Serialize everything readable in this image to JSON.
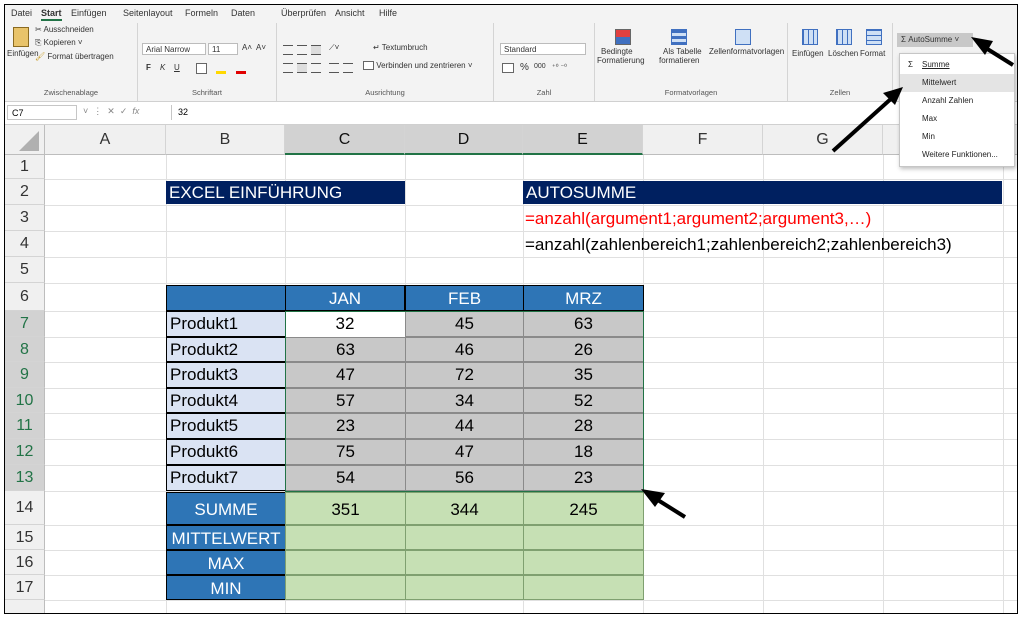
{
  "menu": {
    "tabs": [
      "Datei",
      "Start",
      "Einfügen",
      "Seitenlayout",
      "Formeln",
      "Daten",
      "Überprüfen",
      "Ansicht",
      "Hilfe"
    ]
  },
  "ribbon": {
    "clipboard": {
      "paste_label": "Einfügen",
      "cut_label": "Ausschneiden",
      "copy_label": "Kopieren",
      "format_painter_label": "Format übertragen",
      "group_label": "Zwischenablage"
    },
    "font": {
      "font_name": "Arial Narrow",
      "font_size": "11",
      "grow_label": "A˄",
      "shrink_label": "A˅",
      "bold": "F",
      "italic": "K",
      "underline": "U",
      "group_label": "Schriftart"
    },
    "alignment": {
      "wrap_label": "Textumbruch",
      "merge_label": "Verbinden und zentrieren",
      "group_label": "Ausrichtung"
    },
    "number": {
      "format_value": "Standard",
      "percent": "%",
      "thousands": "000",
      "group_label": "Zahl"
    },
    "styles": {
      "conditional_label_1": "Bedingte",
      "conditional_label_2": "Formatierung",
      "table_label_1": "Als Tabelle",
      "table_label_2": "formatieren",
      "cellstyles_label": "Zellenformatvorlagen",
      "group_label": "Formatvorlagen"
    },
    "cells": {
      "insert_label": "Einfügen",
      "delete_label": "Löschen",
      "format_label": "Format",
      "group_label": "Zellen"
    },
    "editing": {
      "autosum_label": "AutoSumme"
    }
  },
  "autosum_menu": {
    "items": [
      "Summe",
      "Mittelwert",
      "Anzahl Zahlen",
      "Max",
      "Min",
      "Weitere Funktionen..."
    ],
    "highlighted": "Mittelwert"
  },
  "formula_bar": {
    "cell_ref": "C7",
    "fx": "fx",
    "value": "32"
  },
  "columns": [
    "A",
    "B",
    "C",
    "D",
    "E",
    "F",
    "G"
  ],
  "rows": [
    "1",
    "2",
    "3",
    "4",
    "5",
    "6",
    "7",
    "8",
    "9",
    "10",
    "11",
    "12",
    "13",
    "14",
    "15",
    "16",
    "17"
  ],
  "sheet": {
    "title_left": "EXCEL EINFÜHRUNG",
    "title_right": "AUTOSUMME",
    "syntax_generic": "=anzahl(argument1;argument2;argument3,…)",
    "syntax_example": "=anzahl(zahlenbereich1;zahlenbereich2;zahlenbereich3)",
    "headers": [
      "JAN",
      "FEB",
      "MRZ"
    ],
    "products": [
      {
        "name": "Produkt1",
        "values": [
          "32",
          "45",
          "63"
        ]
      },
      {
        "name": "Produkt2",
        "values": [
          "63",
          "46",
          "26"
        ]
      },
      {
        "name": "Produkt3",
        "values": [
          "47",
          "72",
          "35"
        ]
      },
      {
        "name": "Produkt4",
        "values": [
          "57",
          "34",
          "52"
        ]
      },
      {
        "name": "Produkt5",
        "values": [
          "23",
          "44",
          "28"
        ]
      },
      {
        "name": "Produkt6",
        "values": [
          "75",
          "47",
          "18"
        ]
      },
      {
        "name": "Produkt7",
        "values": [
          "54",
          "56",
          "23"
        ]
      }
    ],
    "summary": [
      {
        "label": "SUMME",
        "values": [
          "351",
          "344",
          "245"
        ]
      },
      {
        "label": "MITTELWERT",
        "values": [
          "",
          "",
          ""
        ]
      },
      {
        "label": "MAX",
        "values": [
          "",
          "",
          ""
        ]
      },
      {
        "label": "MIN",
        "values": [
          "",
          "",
          ""
        ]
      }
    ]
  },
  "colors": {
    "navy": "#002060",
    "blue": "#2e75b6",
    "red_text": "#ff0000",
    "lavender": "#dae3f3",
    "gray_cell": "#c8c8c8",
    "green_cell": "#c6e0b4",
    "excel_green": "#217346"
  }
}
